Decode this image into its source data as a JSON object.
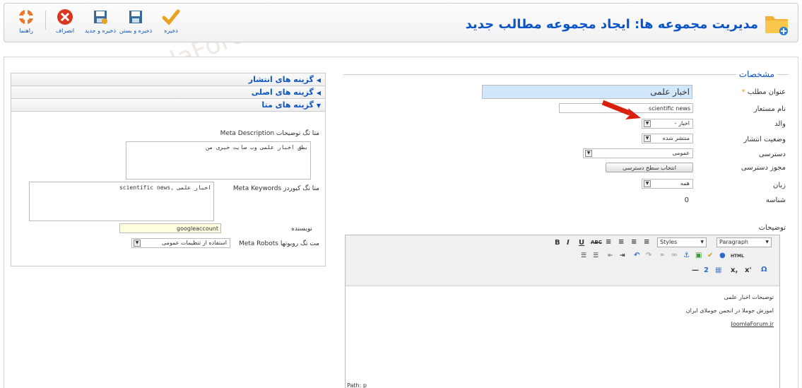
{
  "header": {
    "title": "مدیریت مجموعه ها: ایجاد مجموعه مطالب جدید",
    "toolbar": [
      {
        "name": "help",
        "label": "راهنما",
        "icon": "help-lifebuoy-icon",
        "color": "#e77a2e"
      },
      {
        "name": "cancel",
        "label": "انصراف",
        "icon": "cancel-icon",
        "color": "#d9381e"
      },
      {
        "name": "save-new",
        "label": "ذخیره و جدید",
        "icon": "save-new-icon",
        "color": "#3a6a9a"
      },
      {
        "name": "save-close",
        "label": "ذخیره و بستن",
        "icon": "save-close-icon",
        "color": "#3a6a9a"
      },
      {
        "name": "save",
        "label": "ذخیره",
        "icon": "checkmark-icon",
        "color": "#e8a120"
      }
    ]
  },
  "details": {
    "legend": "مشخصات",
    "title_label": "عنوان مطلب",
    "required_mark": "*",
    "title_value": "اخبار علمی",
    "alias_label": "نام مستعار",
    "alias_value": "scientific news",
    "parent_label": "والد",
    "parent_value": "- اخبار",
    "state_label": "وضعیت انتشار",
    "state_value": "منتشر شده",
    "access_label": "دسترسی",
    "access_value": "عمومی",
    "permissions_label": "مجوز دسترسی",
    "permissions_button": "انتخاب سطح دسترسی",
    "language_label": "زبان",
    "language_value": "همه",
    "id_label": "شناسه",
    "id_value": "0",
    "description_label": "توضیحات"
  },
  "editor": {
    "styles": "Styles",
    "paragraph": "Paragraph",
    "lines": [
      "توضیحات اخبار علمی",
      "اموزش جوملا در انجمن جوملای ایران",
      "JoomlaForum.ir"
    ],
    "path": "Path: p"
  },
  "sidebar": {
    "panels": [
      "گزینه های انتشار",
      "گزینه های اصلی",
      "گزینه های متا"
    ],
    "meta_desc_label": "Meta Description متا تگ توضیحات",
    "meta_desc_value": "بطق اخبار علمی وب سایت خبری من",
    "meta_kw_label": "Meta Keywords متا تگ کیوردز",
    "meta_kw_value": "اخبار علمی ,scientific news",
    "author_label": "نویسنده",
    "author_value": "googleaccount",
    "robots_label": "Meta Robots مت تگ روبوتها",
    "robots_value": "استفاده از تنظیمات عمومی"
  },
  "watermark": "JoomlaForum.ir"
}
